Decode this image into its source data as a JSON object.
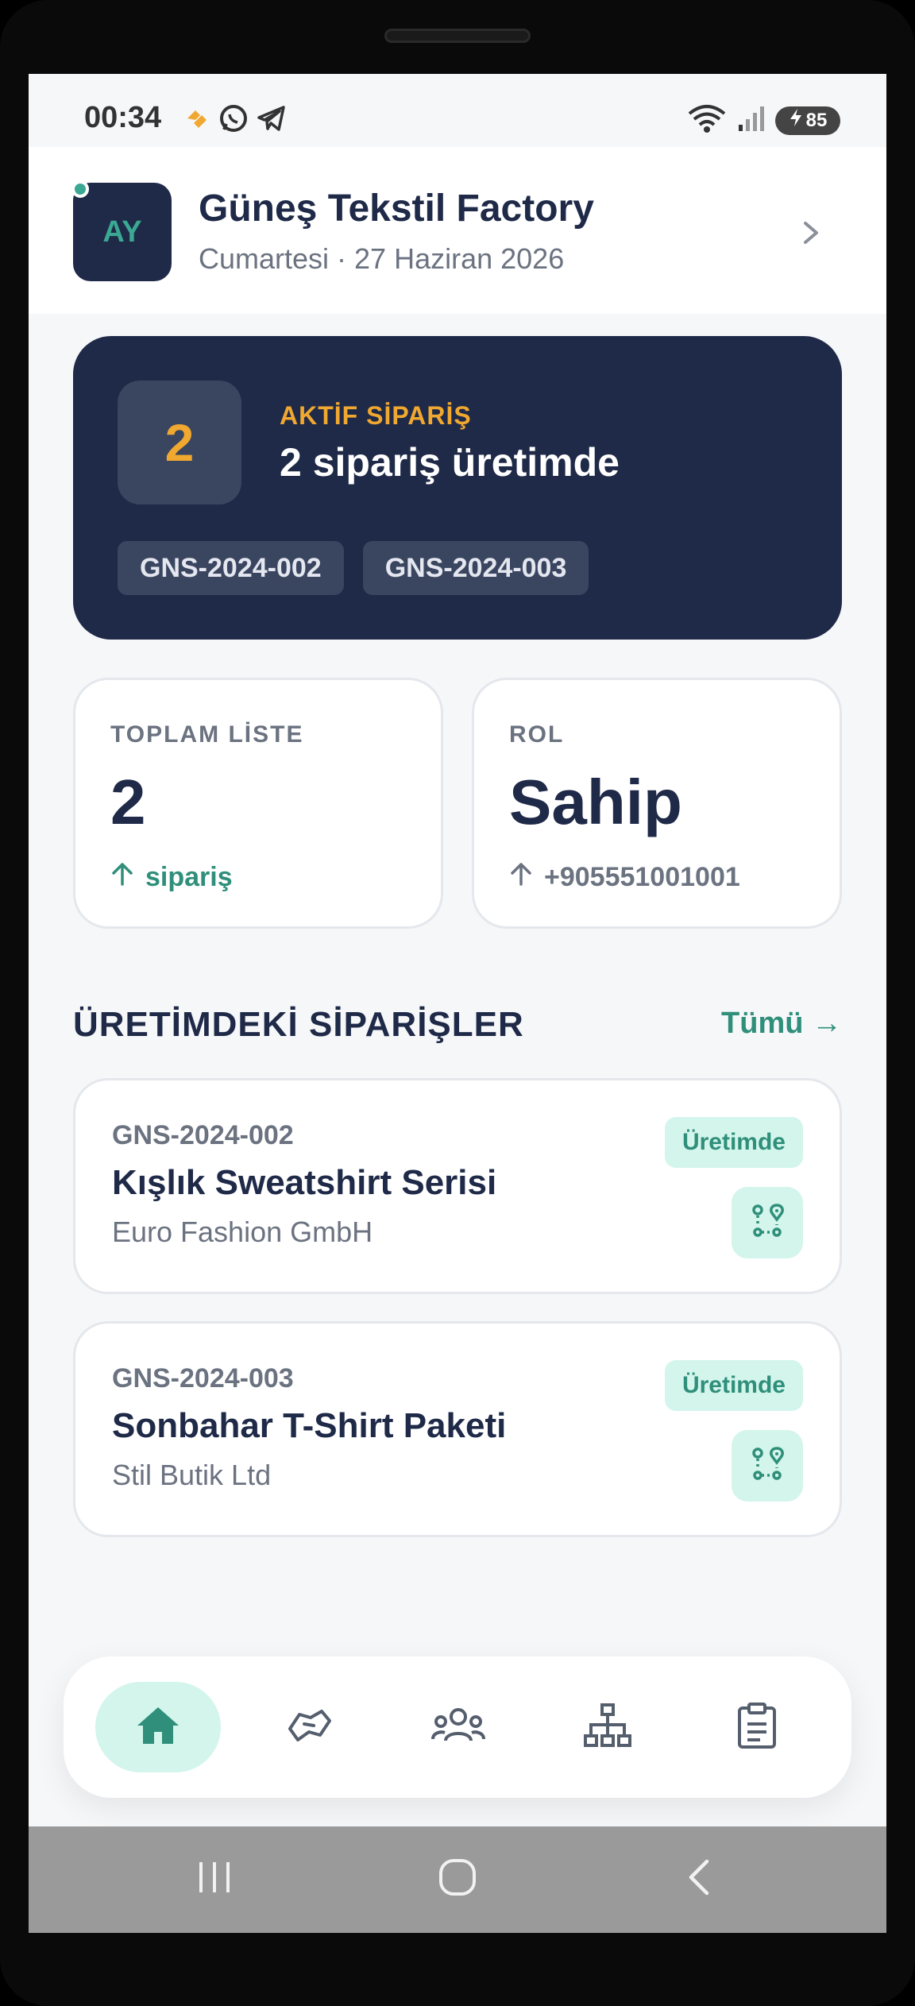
{
  "status_bar": {
    "time": "00:34",
    "battery": "85",
    "icons": [
      "hearts-icon",
      "whatsapp-icon",
      "telegram-icon",
      "wifi-icon",
      "signal-icon",
      "battery-icon"
    ]
  },
  "header": {
    "avatar_initials": "AY",
    "company_name": "Güneş Tekstil Factory",
    "date": "Cumartesi · 27 Haziran 2026"
  },
  "active_orders": {
    "count": "2",
    "label": "AKTİF SİPARİŞ",
    "title": "2 sipariş üretimde",
    "chips": [
      "GNS-2024-002",
      "GNS-2024-003"
    ]
  },
  "stats": {
    "total": {
      "label": "TOPLAM LİSTE",
      "value": "2",
      "sub": "sipariş"
    },
    "role": {
      "label": "ROL",
      "value": "Sahip",
      "sub": "+905551001001"
    }
  },
  "section": {
    "title": "ÜRETİMDEKİ SİPARİŞLER",
    "see_all": "Tümü →"
  },
  "orders": [
    {
      "code": "GNS-2024-002",
      "title": "Kışlık Sweatshirt Serisi",
      "customer": "Euro Fashion GmbH",
      "status": "Üretimde"
    },
    {
      "code": "GNS-2024-003",
      "title": "Sonbahar T-Shirt Paketi",
      "customer": "Stil Butik Ltd",
      "status": "Üretimde"
    }
  ],
  "bottom_nav": [
    "home-icon",
    "handshake-icon",
    "users-icon",
    "sitemap-icon",
    "clipboard-icon"
  ],
  "colors": {
    "navy": "#1f2a48",
    "accent_teal": "#2f8f7a",
    "accent_orange": "#f0a830",
    "mint": "#d3f5ec"
  }
}
